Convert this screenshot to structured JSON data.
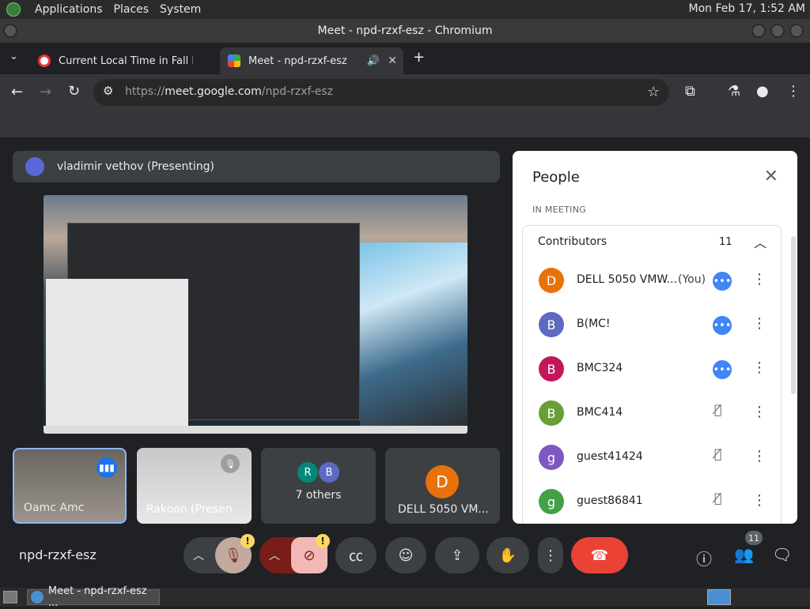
{
  "top_panel": {
    "menus": [
      "Applications",
      "Places",
      "System"
    ],
    "clock": "Mon Feb 17, 1:52 AM"
  },
  "window": {
    "title": "Meet - npd-rzxf-esz - Chromium"
  },
  "tabs": [
    {
      "label": "Current Local Time in Fall Riv",
      "active": false
    },
    {
      "label": "Meet - npd-rzxf-esz",
      "active": true
    }
  ],
  "address_bar": {
    "scheme": "https://",
    "host": "meet.google.com",
    "path": "/npd-rzxf-esz"
  },
  "presenter": {
    "label": "vladimir vethov (Presenting)"
  },
  "tiles": [
    {
      "name": "Oamc Amc"
    },
    {
      "name": "Rakoon (Presen"
    },
    {
      "name": "7 others",
      "avatars": [
        "R",
        "B"
      ]
    },
    {
      "name": "DELL 5050 VM...",
      "avatar": "D"
    }
  ],
  "meeting_code": "npd-rzxf-esz",
  "people_count_badge": "11",
  "people_panel": {
    "title": "People",
    "section": "IN MEETING",
    "group": {
      "label": "Contributors",
      "count": "11"
    },
    "people": [
      {
        "initial": "D",
        "name": "DELL 5050 VMW...",
        "you": "(You)",
        "color": "#e8710a",
        "status": "speaking"
      },
      {
        "initial": "B",
        "name": "B(MC!",
        "you": "",
        "color": "#5c6bc0",
        "status": "speaking"
      },
      {
        "initial": "B",
        "name": "BMC324",
        "you": "",
        "color": "#c2185b",
        "status": "speaking"
      },
      {
        "initial": "B",
        "name": "BMC414",
        "you": "",
        "color": "#689f38",
        "status": "muted"
      },
      {
        "initial": "g",
        "name": "guest41424",
        "you": "",
        "color": "#7e57c2",
        "status": "muted"
      },
      {
        "initial": "g",
        "name": "guest86841",
        "you": "",
        "color": "#43a047",
        "status": "muted"
      }
    ]
  },
  "taskbar": {
    "task_label": "Meet - npd-rzxf-esz ..."
  },
  "colors": {
    "end_call": "#ea4335",
    "accent": "#8ab4f8",
    "warn": "#fdd663"
  }
}
